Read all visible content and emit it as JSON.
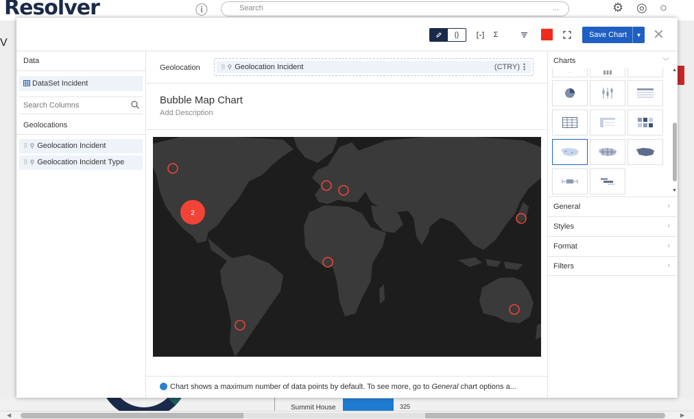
{
  "background": {
    "logo": "Resolver",
    "search_placeholder": "Search",
    "search_more": "...",
    "left_letter": "V",
    "summit_label": "Summit House",
    "summit_value": "325"
  },
  "toolbar": {
    "save_label": "Save Chart",
    "brace_label": "{}",
    "sigma_label": "Σ",
    "color": "#ee2b1d"
  },
  "data_panel": {
    "title": "Data",
    "dataset": "DataSet Incident",
    "search_placeholder": "Search Columns",
    "group": "Geolocations",
    "columns": [
      "Geolocation Incident",
      "Geolocation Incident Type"
    ]
  },
  "geo_field": {
    "label": "Geolocation",
    "chip": "Geolocation Incident",
    "chip_suffix": "(CTRY)"
  },
  "chart": {
    "title": "Bubble Map Chart",
    "description_placeholder": "Add Description"
  },
  "info_text_pre": "Chart shows a maximum number of data points by default. To see more, go to ",
  "info_text_em": "General",
  "info_text_post": " chart options a...",
  "right_panel": {
    "charts_title": "Charts",
    "sections": [
      "General",
      "Styles",
      "Format",
      "Filters"
    ]
  },
  "chart_data": {
    "type": "scatter",
    "title": "Bubble Map Chart",
    "map": "world",
    "bubble_color": "#f04438",
    "points": [
      {
        "location": "Western Canada",
        "count": 1
      },
      {
        "location": "United States",
        "count": 2
      },
      {
        "location": "United Kingdom",
        "count": 1
      },
      {
        "location": "Germany",
        "count": 1
      },
      {
        "location": "Japan",
        "count": 1
      },
      {
        "location": "Nigeria",
        "count": 1
      },
      {
        "location": "Chile",
        "count": 1
      },
      {
        "location": "Australia",
        "count": 1
      }
    ]
  }
}
